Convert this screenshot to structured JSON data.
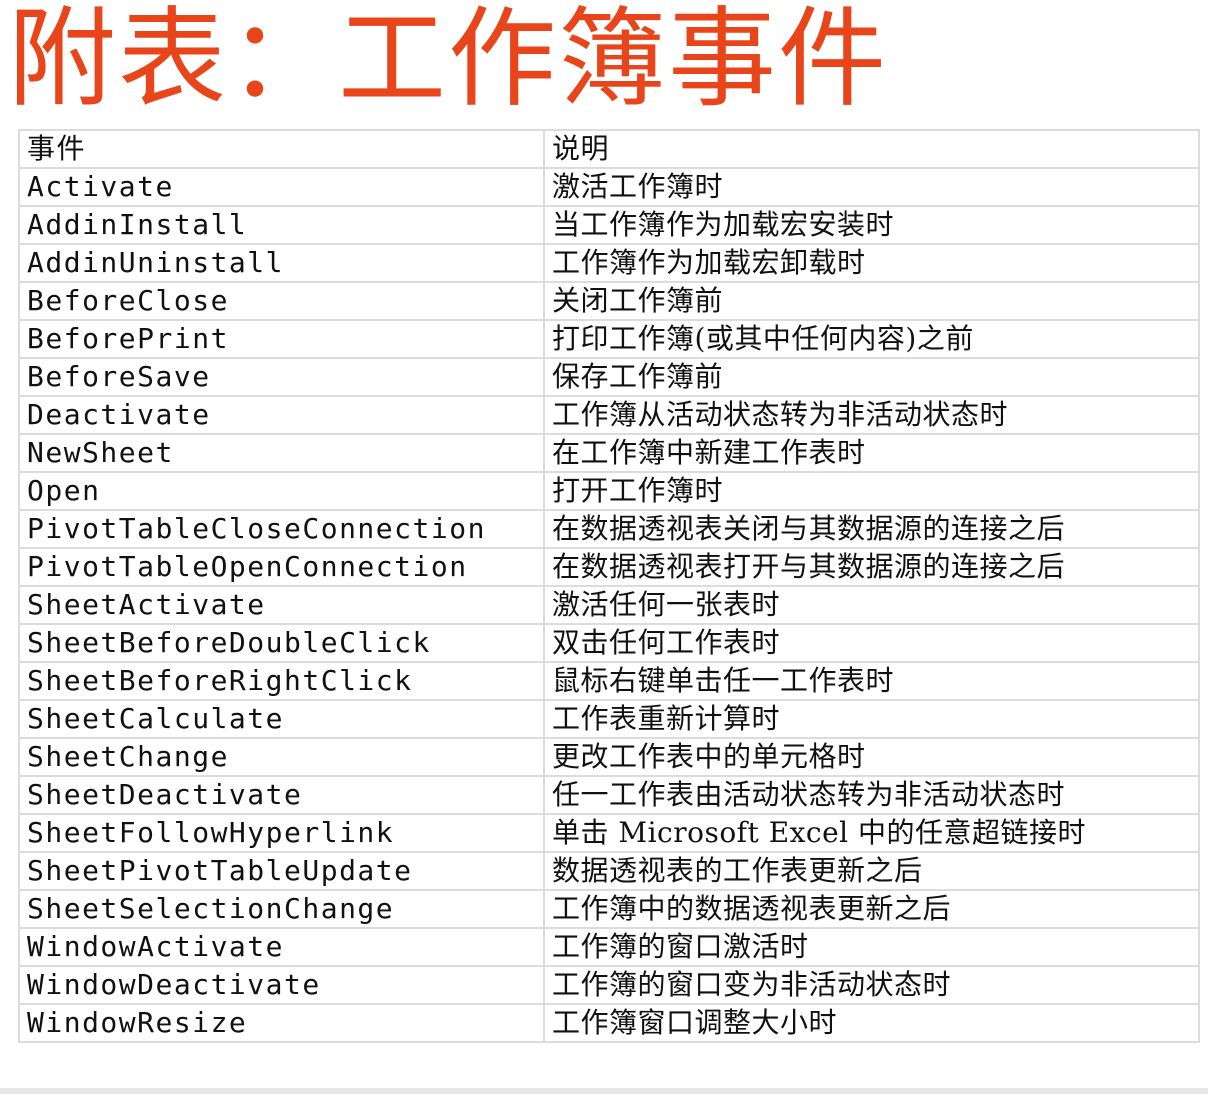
{
  "title": "附表：工作簿事件",
  "table": {
    "headers": [
      "事件",
      "说明"
    ],
    "rows": [
      [
        "Activate",
        "激活工作簿时"
      ],
      [
        "AddinInstall",
        "当工作簿作为加载宏安装时"
      ],
      [
        "AddinUninstall",
        "工作簿作为加载宏卸载时"
      ],
      [
        "BeforeClose",
        "关闭工作簿前"
      ],
      [
        "BeforePrint",
        "打印工作簿(或其中任何内容)之前"
      ],
      [
        "BeforeSave",
        "保存工作簿前"
      ],
      [
        "Deactivate",
        "工作簿从活动状态转为非活动状态时"
      ],
      [
        "NewSheet",
        "在工作簿中新建工作表时"
      ],
      [
        "Open",
        "打开工作簿时"
      ],
      [
        "PivotTableCloseConnection",
        "在数据透视表关闭与其数据源的连接之后"
      ],
      [
        "PivotTableOpenConnection",
        "在数据透视表打开与其数据源的连接之后"
      ],
      [
        "SheetActivate",
        "激活任何一张表时"
      ],
      [
        "SheetBeforeDoubleClick",
        "双击任何工作表时"
      ],
      [
        "SheetBeforeRightClick",
        "鼠标右键单击任一工作表时"
      ],
      [
        "SheetCalculate",
        "工作表重新计算时"
      ],
      [
        "SheetChange",
        "更改工作表中的单元格时"
      ],
      [
        "SheetDeactivate",
        "任一工作表由活动状态转为非活动状态时"
      ],
      [
        "SheetFollowHyperlink",
        "单击 Microsoft Excel 中的任意超链接时"
      ],
      [
        "SheetPivotTableUpdate",
        "数据透视表的工作表更新之后"
      ],
      [
        "SheetSelectionChange",
        "工作簿中的数据透视表更新之后"
      ],
      [
        "WindowActivate",
        "工作簿的窗口激活时"
      ],
      [
        "WindowDeactivate",
        "工作簿的窗口变为非活动状态时"
      ],
      [
        "WindowResize",
        "工作簿窗口调整大小时"
      ]
    ]
  },
  "colors": {
    "title": "#e8461a",
    "grid": "#dcdcdc",
    "text": "#111111"
  }
}
